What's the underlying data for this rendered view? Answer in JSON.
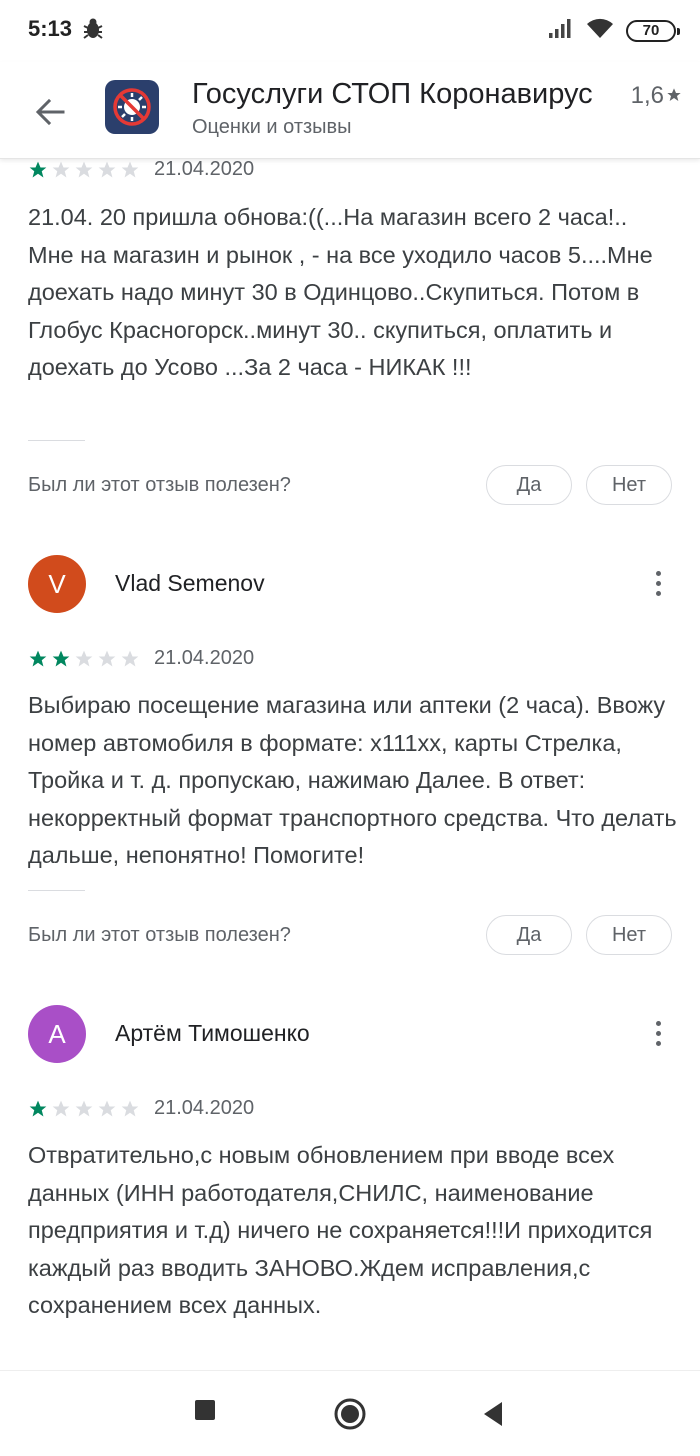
{
  "status_bar": {
    "time": "5:13",
    "battery": "70",
    "icons": [
      "bug-icon",
      "signal-icon",
      "wifi-icon",
      "battery-icon"
    ]
  },
  "header": {
    "title": "Госуслуги СТОП Коронавирус",
    "subtitle": "Оценки и отзывы",
    "rating": "1,6",
    "rating_icon": "star-icon",
    "back_icon": "arrow-back-icon",
    "app_icon": "virus-stop-icon"
  },
  "colors": {
    "star_filled": "#01875f",
    "star_empty": "#dadce0",
    "avatar_v": "#d14b1c",
    "avatar_a": "#a94fc7",
    "app_icon_bg": "#2b3f6c"
  },
  "reviews": [
    {
      "author": "",
      "initial": "",
      "rating": 1,
      "date": "21.04.2020",
      "text": "21.04. 20 пришла обнова:((...На магазин всего 2 часа!.. Мне на магазин и рынок , - на все уходило часов 5....Мне доехать надо минут 30 в Одинцово..Скупиться. Потом в Глобус Красногорск..минут 30.. скупиться, оплатить и доехать до Усово ...За 2 часа - НИКАК !!!",
      "helpful_question": "Был ли этот отзыв полезен?",
      "yes_label": "Да",
      "no_label": "Нет"
    },
    {
      "author": "Vlad Semenov",
      "initial": "V",
      "rating": 2,
      "date": "21.04.2020",
      "text": "Выбираю посещение магазина или аптеки (2 часа). Ввожу номер автомобиля в формате: х111хх, карты Стрелка, Тройка и т. д. пропускаю, нажимаю Далее. В ответ: некорректный формат транспортного средства. Что делать дальше, непонятно! Помогите!",
      "helpful_question": "Был ли этот отзыв полезен?",
      "yes_label": "Да",
      "no_label": "Нет"
    },
    {
      "author": "Артём Тимошенко",
      "initial": "А",
      "rating": 1,
      "date": "21.04.2020",
      "text": "Отвратительно,с новым обновлением при вводе всех данных (ИНН работодателя,СНИЛС, наименование предприятия и т.д) ничего не сохраняется!!!И приходится каждый раз вводить ЗАНОВО.Ждем исправления,с сохранением всех данных."
    }
  ],
  "nav_bar": {
    "buttons": [
      "recents-icon",
      "home-icon",
      "back-nav-icon"
    ]
  }
}
